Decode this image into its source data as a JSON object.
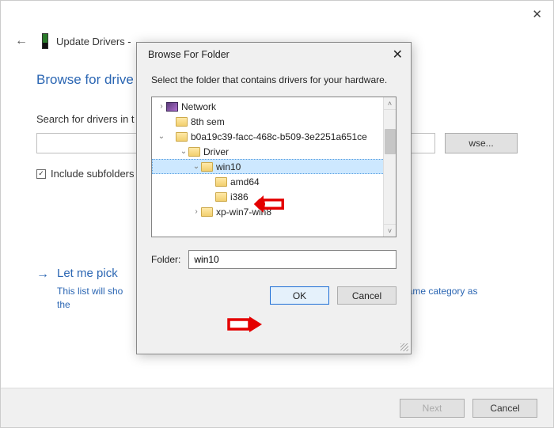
{
  "wizard": {
    "title_prefix": "Update Drivers -",
    "heading": "Browse for drive",
    "instruction": "Search for drivers in t",
    "browse_label": "wse...",
    "include_subfolders_label": "Include subfolders",
    "link_title": "Let me pick ",
    "link_desc_1": "This list will sho",
    "link_desc_2": "n the same category as the",
    "next_label": "Next",
    "cancel_label": "Cancel"
  },
  "modal": {
    "title": "Browse For Folder",
    "instruction": "Select the folder that contains drivers for your hardware.",
    "tree": {
      "network": "Network",
      "eighth_sem": "8th sem",
      "guid": "b0a19c39-facc-468c-b509-3e2251a651ce",
      "driver": "Driver",
      "win10": "win10",
      "amd64": "amd64",
      "i386": "i386",
      "xpwin": "xp-win7-win8"
    },
    "folder_label": "Folder:",
    "folder_value": "win10",
    "ok_label": "OK",
    "cancel_label": "Cancel"
  }
}
